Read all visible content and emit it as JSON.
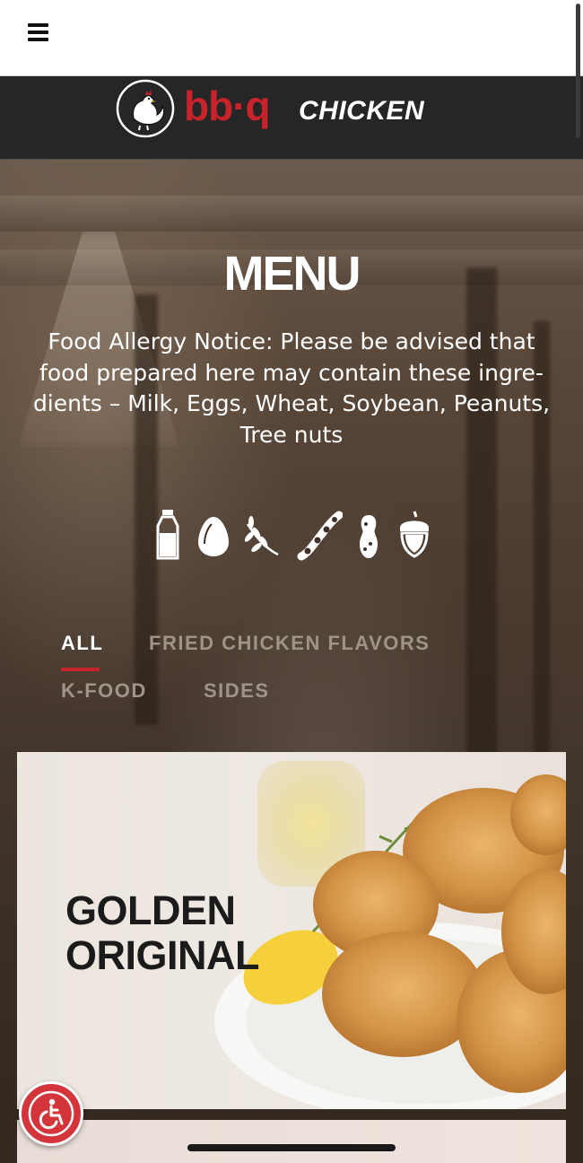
{
  "header": {
    "menu_icon": "hamburger-menu-icon",
    "brand": {
      "wordmark": "bb·q",
      "name": "CHICKEN",
      "colors": {
        "wordmark": "#c8232b",
        "bar_background": "#262626"
      }
    }
  },
  "hero": {
    "title": "MENU",
    "allergy_notice": "Food Allergy Notice: Please be advised that food prepared here may contain these ingre-dients – Milk, Eggs, Wheat, Soybean, Peanuts, Tree nuts",
    "allergen_icons": [
      "milk-bottle-icon",
      "egg-icon",
      "wheat-icon",
      "soybean-icon",
      "peanut-icon",
      "tree-nut-acorn-icon"
    ]
  },
  "tabs": [
    {
      "label": "ALL",
      "active": true
    },
    {
      "label": "FRIED CHICKEN FLAVORS",
      "active": false
    },
    {
      "label": "K-FOOD",
      "active": false
    },
    {
      "label": "SIDES",
      "active": false
    }
  ],
  "menu_cards": [
    {
      "title_line1": "GOLDEN",
      "title_line2": "ORIGINAL"
    }
  ],
  "accessibility_button": {
    "icon": "wheelchair-accessibility-icon",
    "color": "#d3353a"
  },
  "accent_color": "#c8232b"
}
